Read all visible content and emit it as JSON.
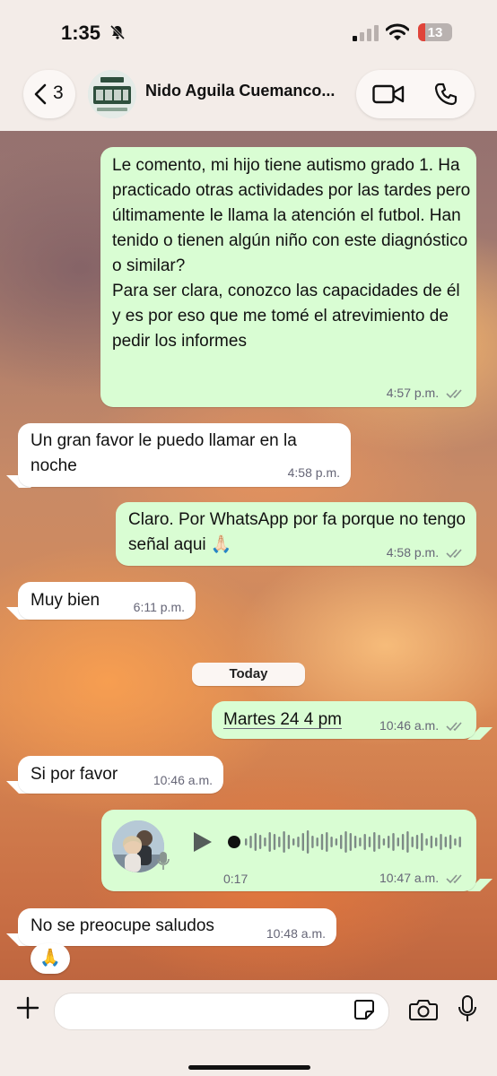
{
  "status_bar": {
    "time": "1:35",
    "battery": "13"
  },
  "header": {
    "back_count": "3",
    "group_name": "Nido Aguila Cuemanco..."
  },
  "messages": [
    {
      "dir": "out",
      "text": "Le comento, mi hijo tiene autismo grado 1. Ha practicado otras actividades por las tardes pero últimamente le llama la atención el futbol. Han tenido o tienen algún niño con este diagnóstico o similar?\nPara ser clara, conozco las capacidades de él y es por eso que me tomé el atrevimiento de pedir los informes",
      "time": "4:57 p.m."
    },
    {
      "dir": "in",
      "text": "Un gran favor le puedo llamar en la noche",
      "time": "4:58 p.m."
    },
    {
      "dir": "out",
      "text": "Claro. Por WhatsApp por fa porque no tengo señal aqui 🙏🏻",
      "time": "4:58 p.m."
    },
    {
      "dir": "in",
      "text": "Muy bien",
      "time": "6:11 p.m."
    },
    {
      "dir": "out",
      "text": "Martes 24 4 pm",
      "time": "10:46 a.m."
    },
    {
      "dir": "in",
      "text": "Si por favor",
      "time": "10:46 a.m."
    },
    {
      "dir": "out",
      "type": "voice",
      "duration": "0:17",
      "time": "10:47 a.m."
    },
    {
      "dir": "in",
      "text": "No se preocupe saludos",
      "time": "10:48 a.m.",
      "reaction": "🙏"
    }
  ],
  "date_separator": "Today",
  "colors": {
    "outgoing": "#d9fdd3",
    "incoming": "#ffffff",
    "ticks": "#8a9590"
  },
  "icons": [
    "chevron-left-icon",
    "video-call-icon",
    "phone-icon",
    "bell-slash-icon",
    "plus-icon",
    "sticker-icon",
    "camera-icon",
    "mic-icon",
    "play-icon"
  ]
}
